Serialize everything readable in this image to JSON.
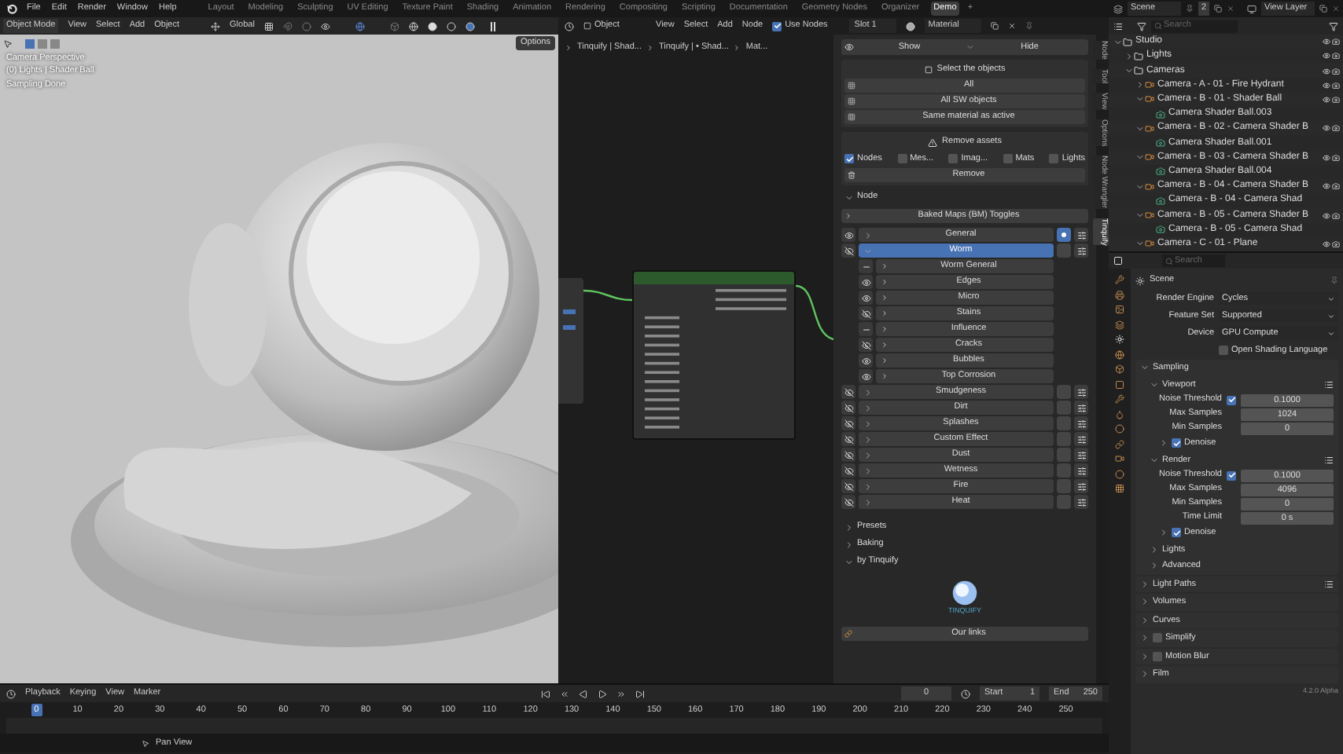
{
  "menu": [
    "File",
    "Edit",
    "Render",
    "Window",
    "Help"
  ],
  "workspaces": [
    {
      "label": "Layout",
      "selected": false
    },
    {
      "label": "Modeling",
      "selected": false
    },
    {
      "label": "Sculpting",
      "selected": false
    },
    {
      "label": "UV Editing",
      "selected": false
    },
    {
      "label": "Texture Paint",
      "selected": false
    },
    {
      "label": "Shading",
      "selected": false
    },
    {
      "label": "Animation",
      "selected": false
    },
    {
      "label": "Rendering",
      "selected": false
    },
    {
      "label": "Compositing",
      "selected": false
    },
    {
      "label": "Scripting",
      "selected": false
    },
    {
      "label": "Documentation",
      "selected": false
    },
    {
      "label": "Geometry Nodes",
      "selected": false
    },
    {
      "label": "Organizer",
      "selected": false
    },
    {
      "label": "Demo",
      "selected": true
    }
  ],
  "add_workspace": "+",
  "scene": {
    "name": "Scene",
    "users": "2"
  },
  "view_layer": "View Layer",
  "viewport": {
    "mode": "Object Mode",
    "menus": [
      "View",
      "Select",
      "Add",
      "Object"
    ],
    "orientation": "Global",
    "options": "Options",
    "overlay": [
      "Camera Perspective",
      "(0) Lights | Shader Ball",
      "Sampling Done"
    ]
  },
  "node_editor": {
    "type": "Object",
    "menus": [
      "View",
      "Select",
      "Add",
      "Node"
    ],
    "use_nodes": {
      "label": "Use Nodes",
      "checked": true
    },
    "slot": "Slot 1",
    "material": "Material",
    "breadcrumbs": [
      "Tinquify | Shad...",
      "Tinquify | • Shad...",
      "Mat..."
    ]
  },
  "sidebar": {
    "show": "Show",
    "hide": "Hide",
    "select_title": "Select the objects",
    "select_buttons": [
      "All",
      "All SW objects",
      "Same material as active"
    ],
    "remove_title": "Remove assets",
    "remove_filters": [
      {
        "label": "Nodes",
        "checked": true
      },
      {
        "label": "Mes...",
        "checked": false
      },
      {
        "label": "Imag...",
        "checked": false
      },
      {
        "label": "Mats",
        "checked": false
      },
      {
        "label": "Lights",
        "checked": false
      }
    ],
    "remove_button": "Remove",
    "node_section": {
      "label": "Node",
      "expanded": true
    },
    "baked_maps": "Baked Maps (BM) Toggles",
    "layers": [
      {
        "label": "General",
        "visible": true,
        "active": true,
        "selected": false,
        "expanded": false
      },
      {
        "label": "Worm",
        "visible": false,
        "active": false,
        "selected": true,
        "expanded": true,
        "children": [
          {
            "label": "Worm General",
            "mixed": true
          },
          {
            "label": "Edges",
            "visible": true
          },
          {
            "label": "Micro",
            "visible": true
          },
          {
            "label": "Stains",
            "visible": false
          },
          {
            "label": "Influence",
            "mixed": true
          },
          {
            "label": "Cracks",
            "visible": false
          },
          {
            "label": "Bubbles",
            "visible": true
          },
          {
            "label": "Top Corrosion",
            "visible": true
          }
        ]
      },
      {
        "label": "Smudgeness",
        "visible": false,
        "active": false,
        "selected": false,
        "expanded": false
      },
      {
        "label": "Dirt",
        "visible": false,
        "active": false,
        "selected": false,
        "expanded": false
      },
      {
        "label": "Splashes",
        "visible": false,
        "active": false,
        "selected": false,
        "expanded": false
      },
      {
        "label": "Custom Effect",
        "visible": false,
        "active": false,
        "selected": false,
        "expanded": false
      },
      {
        "label": "Dust",
        "visible": false,
        "active": false,
        "selected": false,
        "expanded": false
      },
      {
        "label": "Wetness",
        "visible": false,
        "active": false,
        "selected": false,
        "expanded": false
      },
      {
        "label": "Fire",
        "visible": false,
        "active": false,
        "selected": false,
        "expanded": false
      },
      {
        "label": "Heat",
        "visible": false,
        "active": false,
        "selected": false,
        "expanded": false
      }
    ],
    "sections": [
      {
        "label": "Presets",
        "expanded": false
      },
      {
        "label": "Baking",
        "expanded": false
      },
      {
        "label": "by Tinquify",
        "expanded": true
      }
    ],
    "logo_text": "TINQUIFY",
    "links_button": "Our links"
  },
  "sidebar_tabs": [
    {
      "label": "Node",
      "selected": false
    },
    {
      "label": "Tool",
      "selected": false
    },
    {
      "label": "View",
      "selected": false
    },
    {
      "label": "Options",
      "selected": false
    },
    {
      "label": "Node Wrangler",
      "selected": false
    },
    {
      "label": "Tinquify",
      "selected": true
    }
  ],
  "outliner": {
    "search_placeholder": "Search",
    "tree": [
      {
        "label": "Studio",
        "kind": "collection",
        "expanded": true,
        "children": [
          {
            "label": "Lights",
            "kind": "collection",
            "expanded": false
          },
          {
            "label": "Cameras",
            "kind": "collection",
            "expanded": true,
            "children": [
              {
                "label": "Camera - A - 01 - Fire Hydrant",
                "kind": "camera",
                "expanded": false
              },
              {
                "label": "Camera - B - 01 - Shader Ball",
                "kind": "camera",
                "expanded": true,
                "children": [
                  {
                    "label": "Camera Shader Ball.003",
                    "kind": "camera_data"
                  }
                ]
              },
              {
                "label": "Camera - B - 02 - Camera Shader B",
                "kind": "camera",
                "expanded": true,
                "children": [
                  {
                    "label": "Camera Shader Ball.001",
                    "kind": "camera_data"
                  }
                ]
              },
              {
                "label": "Camera - B - 03 - Camera Shader B",
                "kind": "camera",
                "expanded": true,
                "children": [
                  {
                    "label": "Camera Shader Ball.004",
                    "kind": "camera_data"
                  }
                ]
              },
              {
                "label": "Camera - B - 04 - Camera Shader B",
                "kind": "camera",
                "expanded": true,
                "children": [
                  {
                    "label": "Camera - B - 04 - Camera Shad",
                    "kind": "camera_data"
                  }
                ]
              },
              {
                "label": "Camera - B - 05 - Camera Shader B",
                "kind": "camera",
                "expanded": true,
                "children": [
                  {
                    "label": "Camera - B - 05 - Camera Shad",
                    "kind": "camera_data"
                  }
                ]
              },
              {
                "label": "Camera - C - 01 - Plane",
                "kind": "camera",
                "expanded": true
              }
            ]
          }
        ]
      }
    ]
  },
  "properties": {
    "search_placeholder": "Search",
    "context": "Scene",
    "settings": [
      {
        "label": "Render Engine",
        "value": "Cycles"
      },
      {
        "label": "Feature Set",
        "value": "Supported"
      },
      {
        "label": "Device",
        "value": "GPU Compute"
      }
    ],
    "osl": {
      "label": "Open Shading Language",
      "checked": false
    },
    "panels": [
      {
        "label": "Sampling",
        "expanded": true,
        "children": [
          {
            "label": "Viewport",
            "expanded": true,
            "presets": true,
            "fields": [
              {
                "label": "Noise Threshold",
                "checked": true,
                "value": "0.1000"
              },
              {
                "label": "Max Samples",
                "value": "1024"
              },
              {
                "label": "Min Samples",
                "value": "0"
              }
            ],
            "children": [
              {
                "label": "Denoise",
                "expanded": false,
                "checked": true
              }
            ]
          },
          {
            "label": "Render",
            "expanded": true,
            "presets": true,
            "fields": [
              {
                "label": "Noise Threshold",
                "checked": true,
                "value": "0.1000"
              },
              {
                "label": "Max Samples",
                "value": "4096"
              },
              {
                "label": "Min Samples",
                "value": "0"
              },
              {
                "label": "Time Limit",
                "value": "0 s"
              }
            ],
            "children": [
              {
                "label": "Denoise",
                "expanded": false,
                "checked": true
              }
            ]
          },
          {
            "label": "Lights",
            "expanded": false
          },
          {
            "label": "Advanced",
            "expanded": false
          }
        ]
      },
      {
        "label": "Light Paths",
        "expanded": false,
        "presets": true
      },
      {
        "label": "Volumes",
        "expanded": false
      },
      {
        "label": "Curves",
        "expanded": false
      },
      {
        "label": "Simplify",
        "expanded": false,
        "checked": false
      },
      {
        "label": "Motion Blur",
        "expanded": false,
        "checked": false
      },
      {
        "label": "Film",
        "expanded": false
      }
    ]
  },
  "timeline": {
    "menus": [
      "Playback",
      "Keying",
      "View",
      "Marker"
    ],
    "current_frame": "0",
    "start_label": "Start",
    "start": "1",
    "end_label": "End",
    "end": "250",
    "ticks": [
      {
        "label": "0",
        "selected": true
      },
      {
        "label": "10",
        "selected": false
      },
      {
        "label": "20",
        "selected": false
      },
      {
        "label": "30",
        "selected": false
      },
      {
        "label": "40",
        "selected": false
      },
      {
        "label": "50",
        "selected": false
      },
      {
        "label": "60",
        "selected": false
      },
      {
        "label": "70",
        "selected": false
      },
      {
        "label": "80",
        "selected": false
      },
      {
        "label": "90",
        "selected": false
      },
      {
        "label": "100",
        "selected": false
      },
      {
        "label": "110",
        "selected": false
      },
      {
        "label": "120",
        "selected": false
      },
      {
        "label": "130",
        "selected": false
      },
      {
        "label": "140",
        "selected": false
      },
      {
        "label": "150",
        "selected": false
      },
      {
        "label": "160",
        "selected": false
      },
      {
        "label": "170",
        "selected": false
      },
      {
        "label": "180",
        "selected": false
      },
      {
        "label": "190",
        "selected": false
      },
      {
        "label": "200",
        "selected": false
      },
      {
        "label": "210",
        "selected": false
      },
      {
        "label": "220",
        "selected": false
      },
      {
        "label": "230",
        "selected": false
      },
      {
        "label": "240",
        "selected": false
      },
      {
        "label": "250",
        "selected": false
      }
    ]
  },
  "status_bar": {
    "hint": "Pan View",
    "version": "4.2.0 Alpha"
  }
}
